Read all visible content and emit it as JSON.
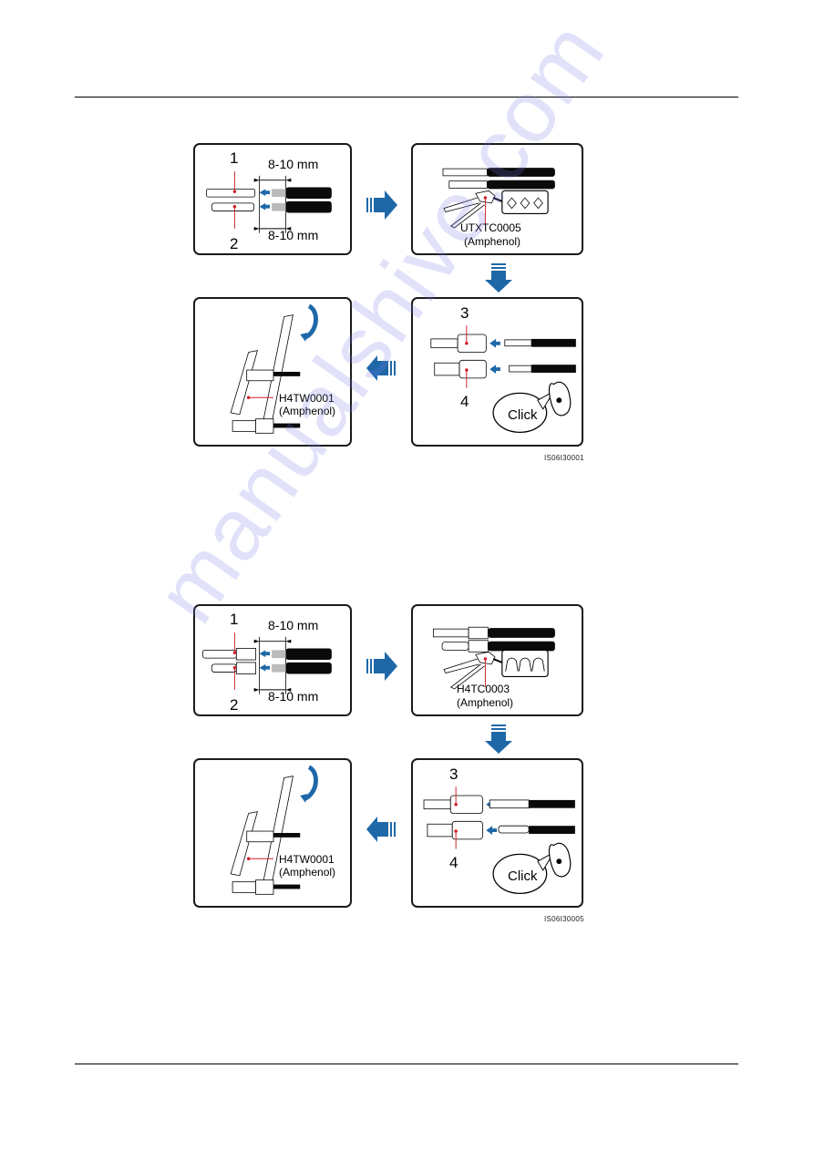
{
  "page": {
    "watermark": "manualshive.com"
  },
  "figures": [
    {
      "id": "IS06I30001",
      "panels": {
        "strip": {
          "number_top": "1",
          "number_bottom": "2",
          "dim_top": "8-10 mm",
          "dim_bottom": "8-10 mm"
        },
        "crimp": {
          "tool_model": "UTXTC0005",
          "tool_brand": "(Amphenol)",
          "die_shape": "hexagonal"
        },
        "insert": {
          "number_top": "3",
          "number_bottom": "4",
          "bubble_text": "Click"
        },
        "tighten": {
          "tool_model": "H4TW0001",
          "tool_brand": "(Amphenol)"
        }
      },
      "arrows": [
        "right-arrow",
        "down-arrow",
        "left-arrow"
      ]
    },
    {
      "id": "IS06I30005",
      "panels": {
        "strip": {
          "number_top": "1",
          "number_bottom": "2",
          "dim_top": "8-10 mm",
          "dim_bottom": "8-10 mm"
        },
        "crimp": {
          "tool_model": "H4TC0003",
          "tool_brand": "(Amphenol)",
          "die_shape": "round"
        },
        "insert": {
          "number_top": "3",
          "number_bottom": "4",
          "bubble_text": "Click"
        },
        "tighten": {
          "tool_model": "H4TW0001",
          "tool_brand": "(Amphenol)"
        }
      },
      "arrows": [
        "right-arrow",
        "down-arrow",
        "left-arrow"
      ]
    }
  ],
  "colors": {
    "arrow_blue": "#1f68a8",
    "callout_red": "#d0202a",
    "panel_border": "#1a1a1a",
    "cable_black": "#0a0a0a"
  }
}
